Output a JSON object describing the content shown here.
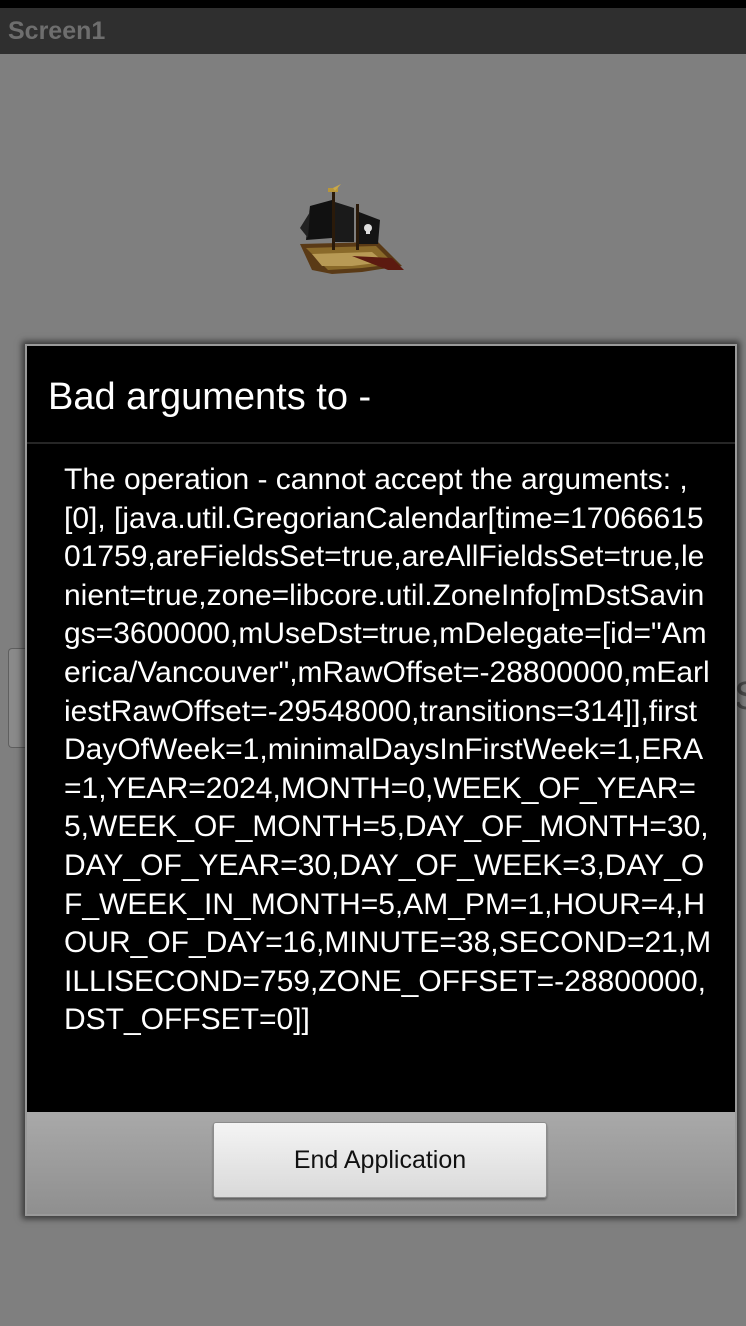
{
  "app": {
    "title": "Screen1"
  },
  "dialog": {
    "title": "Bad arguments to -",
    "message": "The operation - cannot accept the arguments: , [0], [java.util.GregorianCalendar[time=1706661501759,areFieldsSet=true,areAllFieldsSet=true,lenient=true,zone=libcore.util.ZoneInfo[mDstSavings=3600000,mUseDst=true,mDelegate=[id=\"America/Vancouver\",mRawOffset=-28800000,mEarliestRawOffset=-29548000,transitions=314]],firstDayOfWeek=1,minimalDaysInFirstWeek=1,ERA=1,YEAR=2024,MONTH=0,WEEK_OF_YEAR=5,WEEK_OF_MONTH=5,DAY_OF_MONTH=30,DAY_OF_YEAR=30,DAY_OF_WEEK=3,DAY_OF_WEEK_IN_MONTH=5,AM_PM=1,HOUR=4,HOUR_OF_DAY=16,MINUTE=38,SECOND=21,MILLISECOND=759,ZONE_OFFSET=-28800000,DST_OFFSET=0]]",
    "button_label": "End Application"
  },
  "background": {
    "image_icon": "pirate-ship-icon"
  },
  "colors": {
    "screen_background": "#7f7f7f",
    "title_bar": "#2f2f2f",
    "dialog_background": "#000000",
    "dialog_text": "#ffffff",
    "button_bar": "#9c9c9c"
  }
}
